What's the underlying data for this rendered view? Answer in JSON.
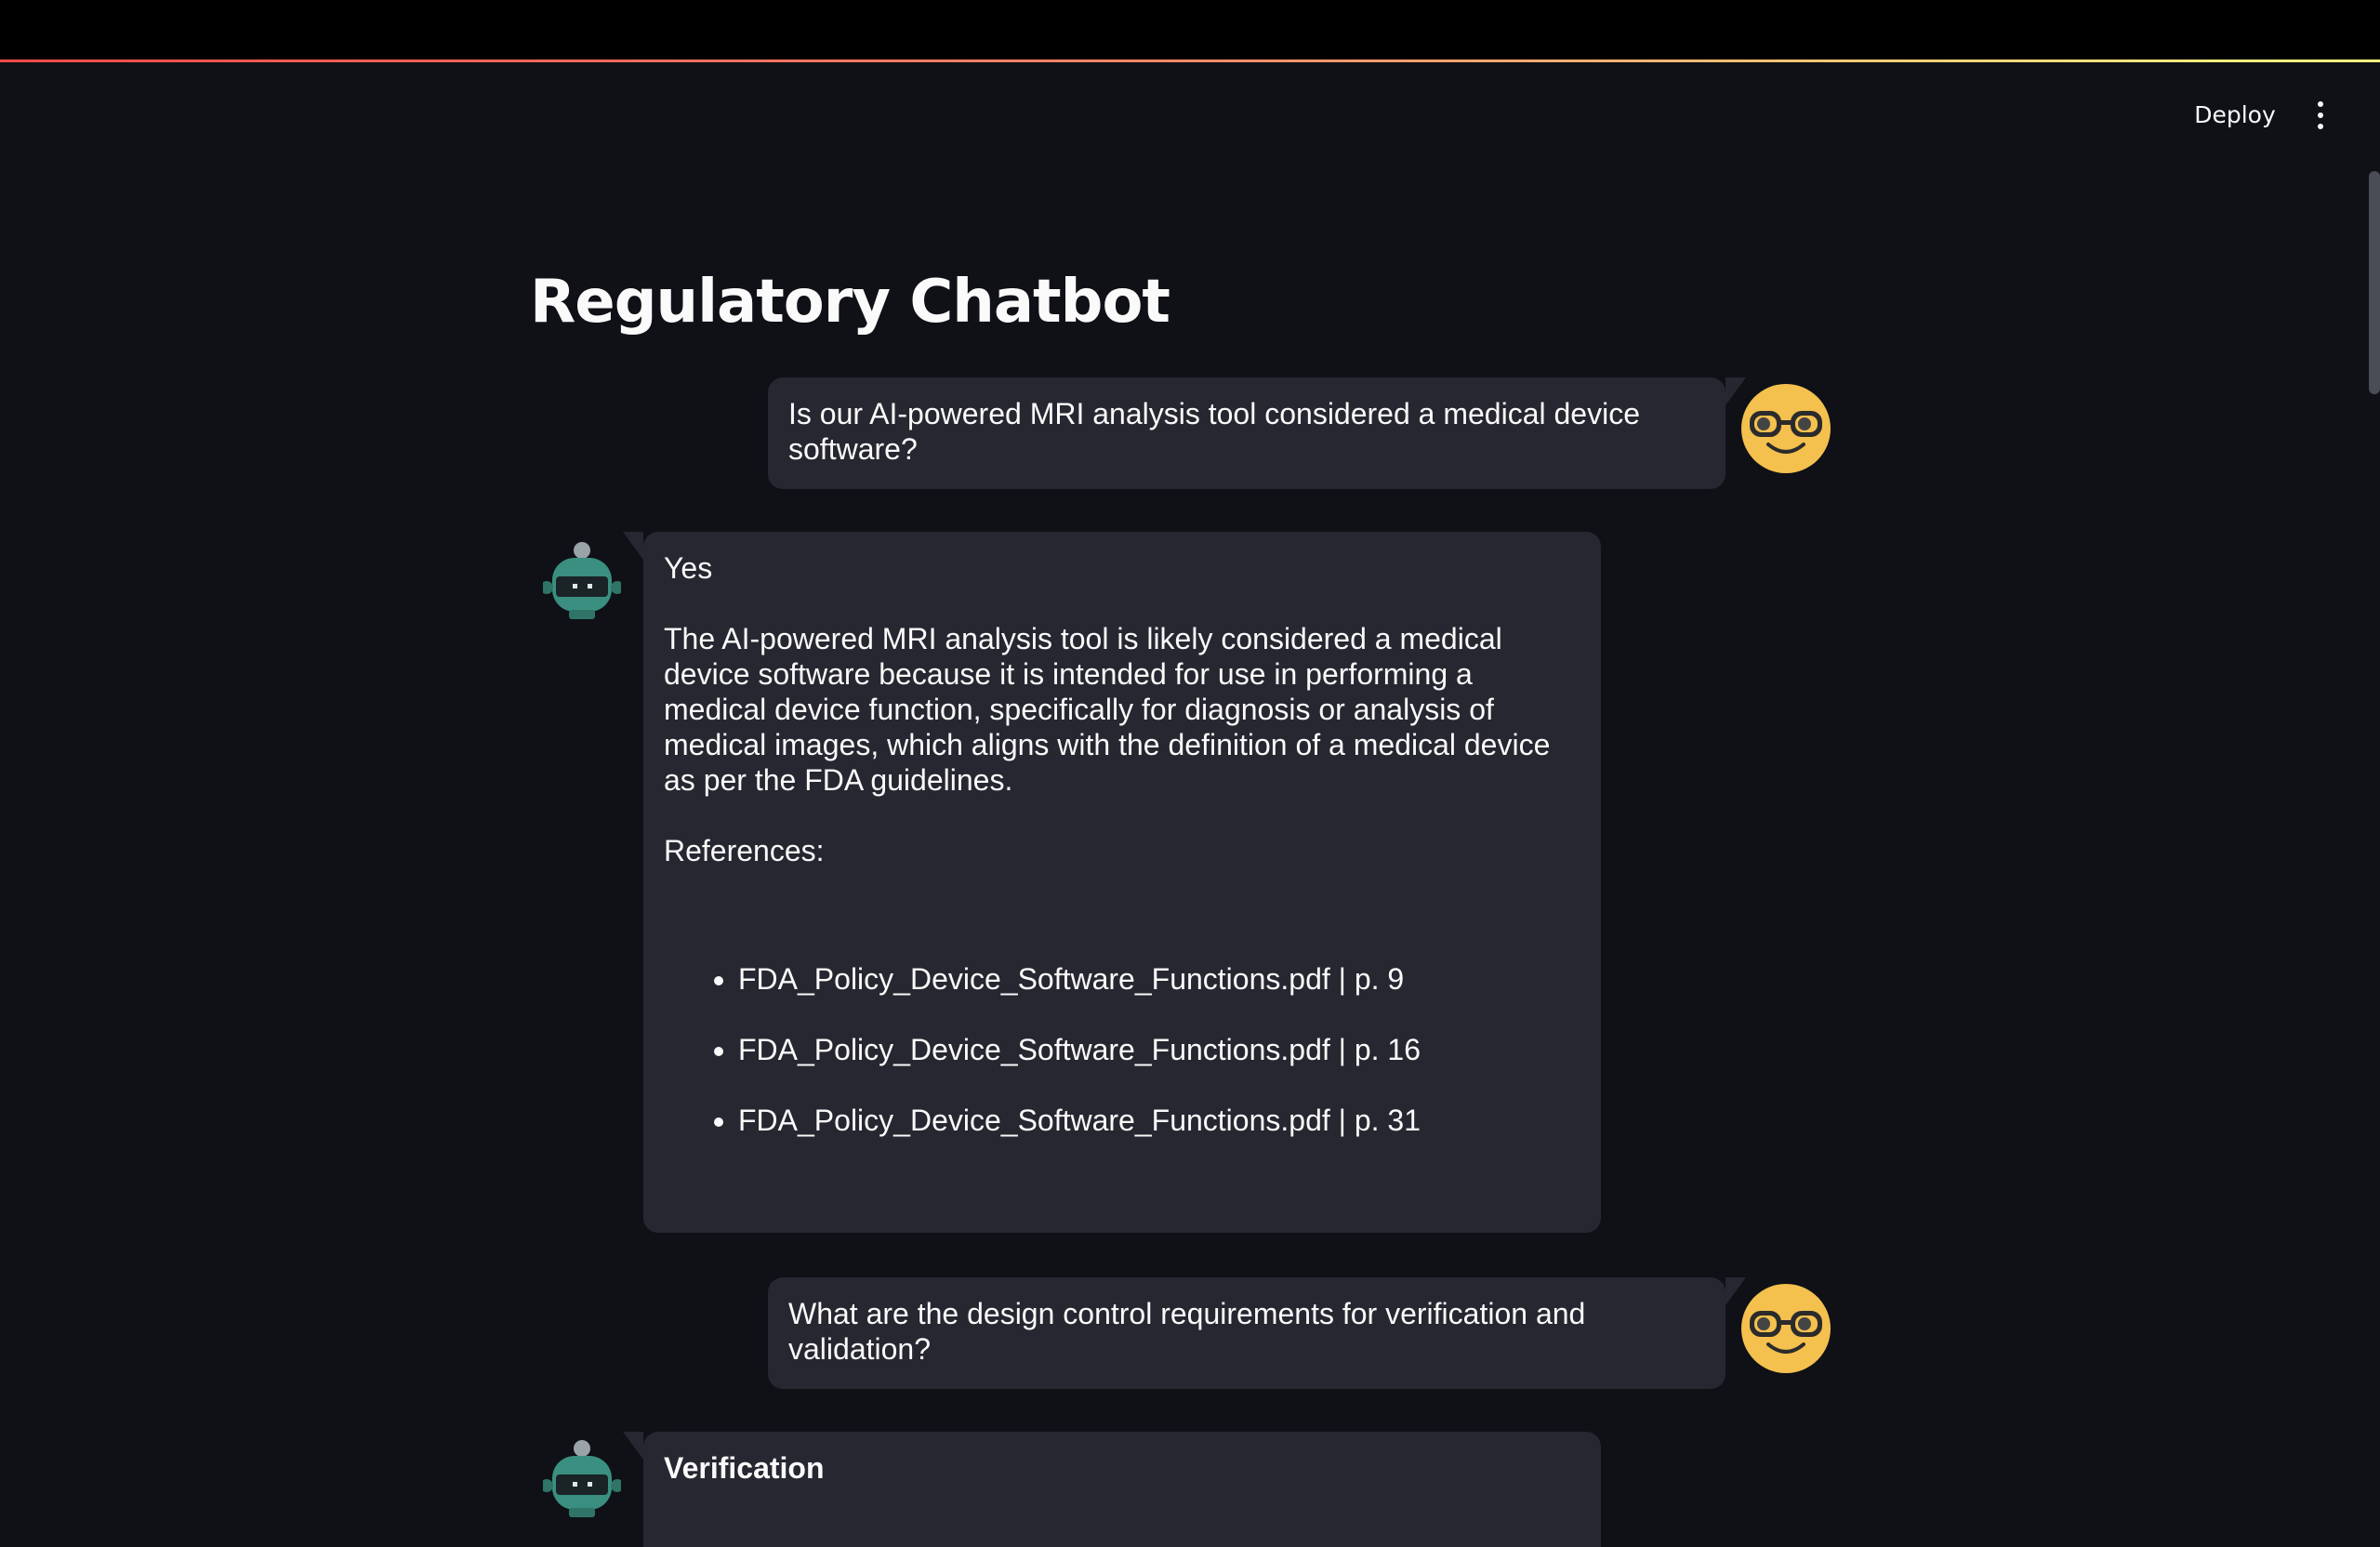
{
  "app": {
    "title": "Regulatory Chatbot",
    "deploy_label": "Deploy",
    "menu_icon": "kebab-menu-icon"
  },
  "messages": [
    {
      "role": "user",
      "avatar_icon": "nerd-face-icon",
      "text": "Is our AI-powered MRI analysis tool considered a medical device software?"
    },
    {
      "role": "assistant",
      "avatar_icon": "robot-icon",
      "answer": "Yes",
      "explanation": "The AI-powered MRI analysis tool is likely considered a medical device software because it is intended for use in performing a medical device function, specifically for diagnosis or analysis of medical images, which aligns with the definition of a medical device as per the FDA guidelines.",
      "references_label": "References:",
      "references": [
        "FDA_Policy_Device_Software_Functions.pdf | p. 9",
        "FDA_Policy_Device_Software_Functions.pdf | p. 16",
        "FDA_Policy_Device_Software_Functions.pdf | p. 31"
      ]
    },
    {
      "role": "user",
      "avatar_icon": "nerd-face-icon",
      "text": "What are the design control requirements for verification and validation?"
    },
    {
      "role": "assistant",
      "avatar_icon": "robot-icon",
      "heading": "Verification"
    }
  ],
  "colors": {
    "background": "#0f1117",
    "bubble": "#262730",
    "text": "#fafafa",
    "user_avatar": "#f4c04e",
    "bot_avatar": "#3a8f80"
  }
}
